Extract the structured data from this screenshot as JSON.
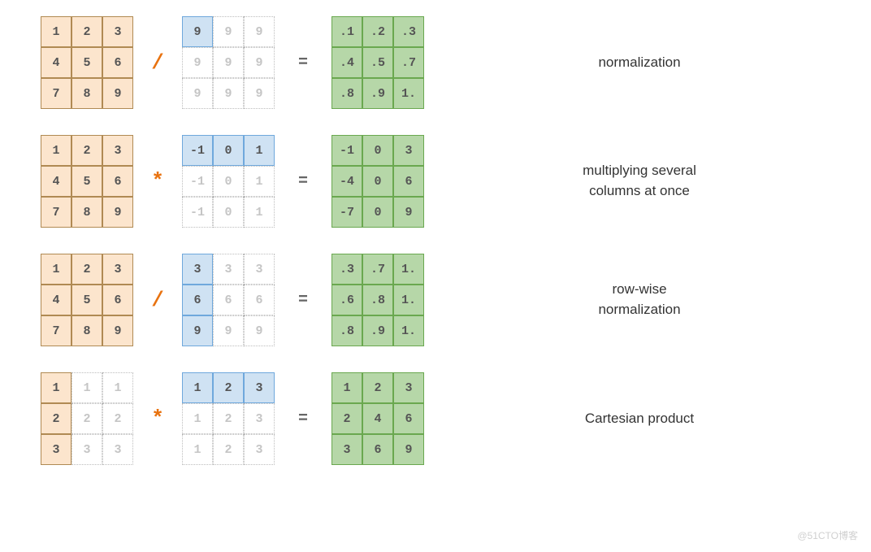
{
  "watermark": "@51CTO博客",
  "operators": {
    "div": "/",
    "mul": "*",
    "eq": "="
  },
  "rows": [
    {
      "op": "div",
      "label": "normalization",
      "left": {
        "cells": [
          "1",
          "2",
          "3",
          "4",
          "5",
          "6",
          "7",
          "8",
          "9"
        ],
        "styles": [
          "orange",
          "orange",
          "orange",
          "orange",
          "orange",
          "orange",
          "orange",
          "orange",
          "orange"
        ]
      },
      "mid": {
        "cells": [
          "9",
          "9",
          "9",
          "9",
          "9",
          "9",
          "9",
          "9",
          "9"
        ],
        "styles": [
          "blue",
          "blue-ghost",
          "blue-ghost",
          "blue-ghost",
          "blue-ghost",
          "blue-ghost",
          "blue-ghost",
          "blue-ghost",
          "blue-ghost"
        ]
      },
      "right": {
        "cells": [
          ".1",
          ".2",
          ".3",
          ".4",
          ".5",
          ".7",
          ".8",
          ".9",
          "1."
        ],
        "styles": [
          "green",
          "green",
          "green",
          "green",
          "green",
          "green",
          "green",
          "green",
          "green"
        ]
      }
    },
    {
      "op": "mul",
      "label": "multiplying several\ncolumns at once",
      "left": {
        "cells": [
          "1",
          "2",
          "3",
          "4",
          "5",
          "6",
          "7",
          "8",
          "9"
        ],
        "styles": [
          "orange",
          "orange",
          "orange",
          "orange",
          "orange",
          "orange",
          "orange",
          "orange",
          "orange"
        ]
      },
      "mid": {
        "cells": [
          "-1",
          "0",
          "1",
          "-1",
          "0",
          "1",
          "-1",
          "0",
          "1"
        ],
        "styles": [
          "blue",
          "blue",
          "blue",
          "blue-ghost",
          "blue-ghost",
          "blue-ghost",
          "blue-ghost",
          "blue-ghost",
          "blue-ghost"
        ]
      },
      "right": {
        "cells": [
          "-1",
          "0",
          "3",
          "-4",
          "0",
          "6",
          "-7",
          "0",
          "9"
        ],
        "styles": [
          "green",
          "green",
          "green",
          "green",
          "green",
          "green",
          "green",
          "green",
          "green"
        ]
      }
    },
    {
      "op": "div",
      "label": "row-wise\nnormalization",
      "left": {
        "cells": [
          "1",
          "2",
          "3",
          "4",
          "5",
          "6",
          "7",
          "8",
          "9"
        ],
        "styles": [
          "orange",
          "orange",
          "orange",
          "orange",
          "orange",
          "orange",
          "orange",
          "orange",
          "orange"
        ]
      },
      "mid": {
        "cells": [
          "3",
          "3",
          "3",
          "6",
          "6",
          "6",
          "9",
          "9",
          "9"
        ],
        "styles": [
          "blue",
          "blue-ghost",
          "blue-ghost",
          "blue",
          "blue-ghost",
          "blue-ghost",
          "blue",
          "blue-ghost",
          "blue-ghost"
        ]
      },
      "right": {
        "cells": [
          ".3",
          ".7",
          "1.",
          ".6",
          ".8",
          "1.",
          ".8",
          ".9",
          "1."
        ],
        "styles": [
          "green",
          "green",
          "green",
          "green",
          "green",
          "green",
          "green",
          "green",
          "green"
        ]
      }
    },
    {
      "op": "mul",
      "label": "Cartesian product",
      "left": {
        "cells": [
          "1",
          "1",
          "1",
          "2",
          "2",
          "2",
          "3",
          "3",
          "3"
        ],
        "styles": [
          "orange",
          "orange-ghost",
          "orange-ghost",
          "orange",
          "orange-ghost",
          "orange-ghost",
          "orange",
          "orange-ghost",
          "orange-ghost"
        ]
      },
      "mid": {
        "cells": [
          "1",
          "2",
          "3",
          "1",
          "2",
          "3",
          "1",
          "2",
          "3"
        ],
        "styles": [
          "blue",
          "blue",
          "blue",
          "blue-ghost",
          "blue-ghost",
          "blue-ghost",
          "blue-ghost",
          "blue-ghost",
          "blue-ghost"
        ]
      },
      "right": {
        "cells": [
          "1",
          "2",
          "3",
          "2",
          "4",
          "6",
          "3",
          "6",
          "9"
        ],
        "styles": [
          "green",
          "green",
          "green",
          "green",
          "green",
          "green",
          "green",
          "green",
          "green"
        ]
      }
    }
  ]
}
